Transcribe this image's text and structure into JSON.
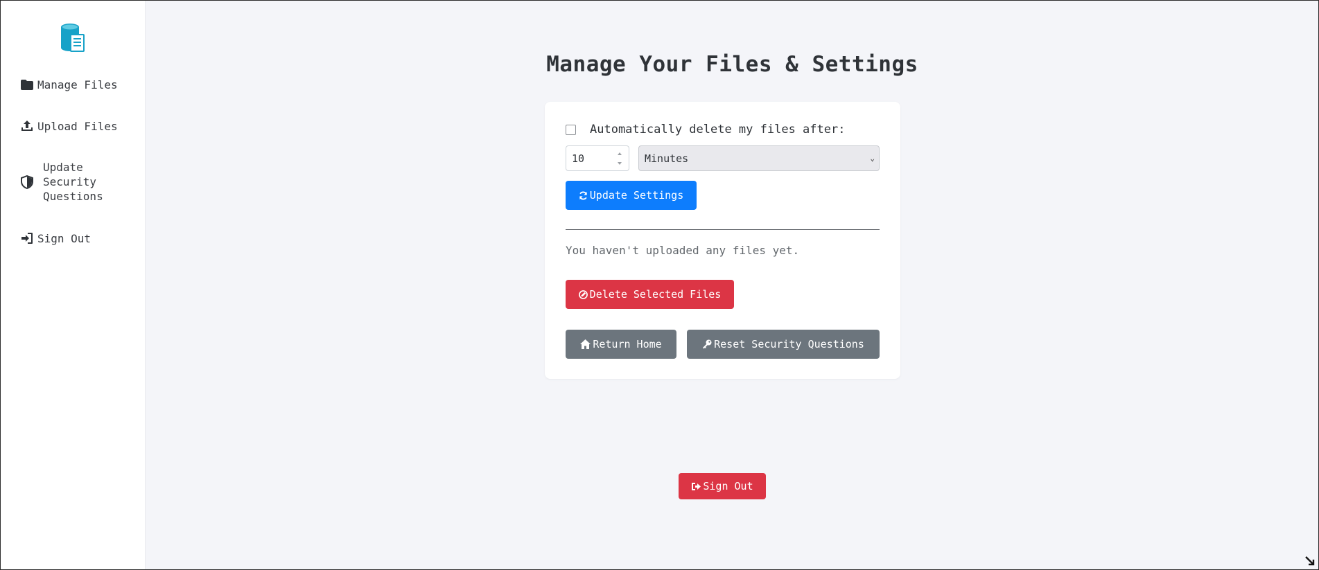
{
  "sidebar": {
    "logo_icon": "database-document-icon",
    "items": [
      {
        "icon": "folder-icon",
        "label": "Manage Files"
      },
      {
        "icon": "upload-icon",
        "label": "Upload Files"
      },
      {
        "icon": "shield-icon",
        "label_lines": [
          "Update",
          "Security",
          "Questions"
        ]
      },
      {
        "icon": "sign-in-icon",
        "label": "Sign Out"
      }
    ]
  },
  "main": {
    "title": "Manage Your Files & Settings",
    "auto_delete": {
      "checked": false,
      "label": "Automatically delete my files after:",
      "amount_value": "10",
      "unit_value": "Minutes"
    },
    "update_button": "Update Settings",
    "empty_message": "You haven't uploaded any files yet.",
    "delete_button": "Delete Selected Files",
    "return_home_button": "Return Home",
    "reset_security_button": "Reset Security Questions",
    "sign_out_button": "Sign Out"
  },
  "colors": {
    "primary": "#0d7dfd",
    "danger": "#dc3545",
    "secondary": "#6c757d",
    "logo": "#17a2c8"
  }
}
